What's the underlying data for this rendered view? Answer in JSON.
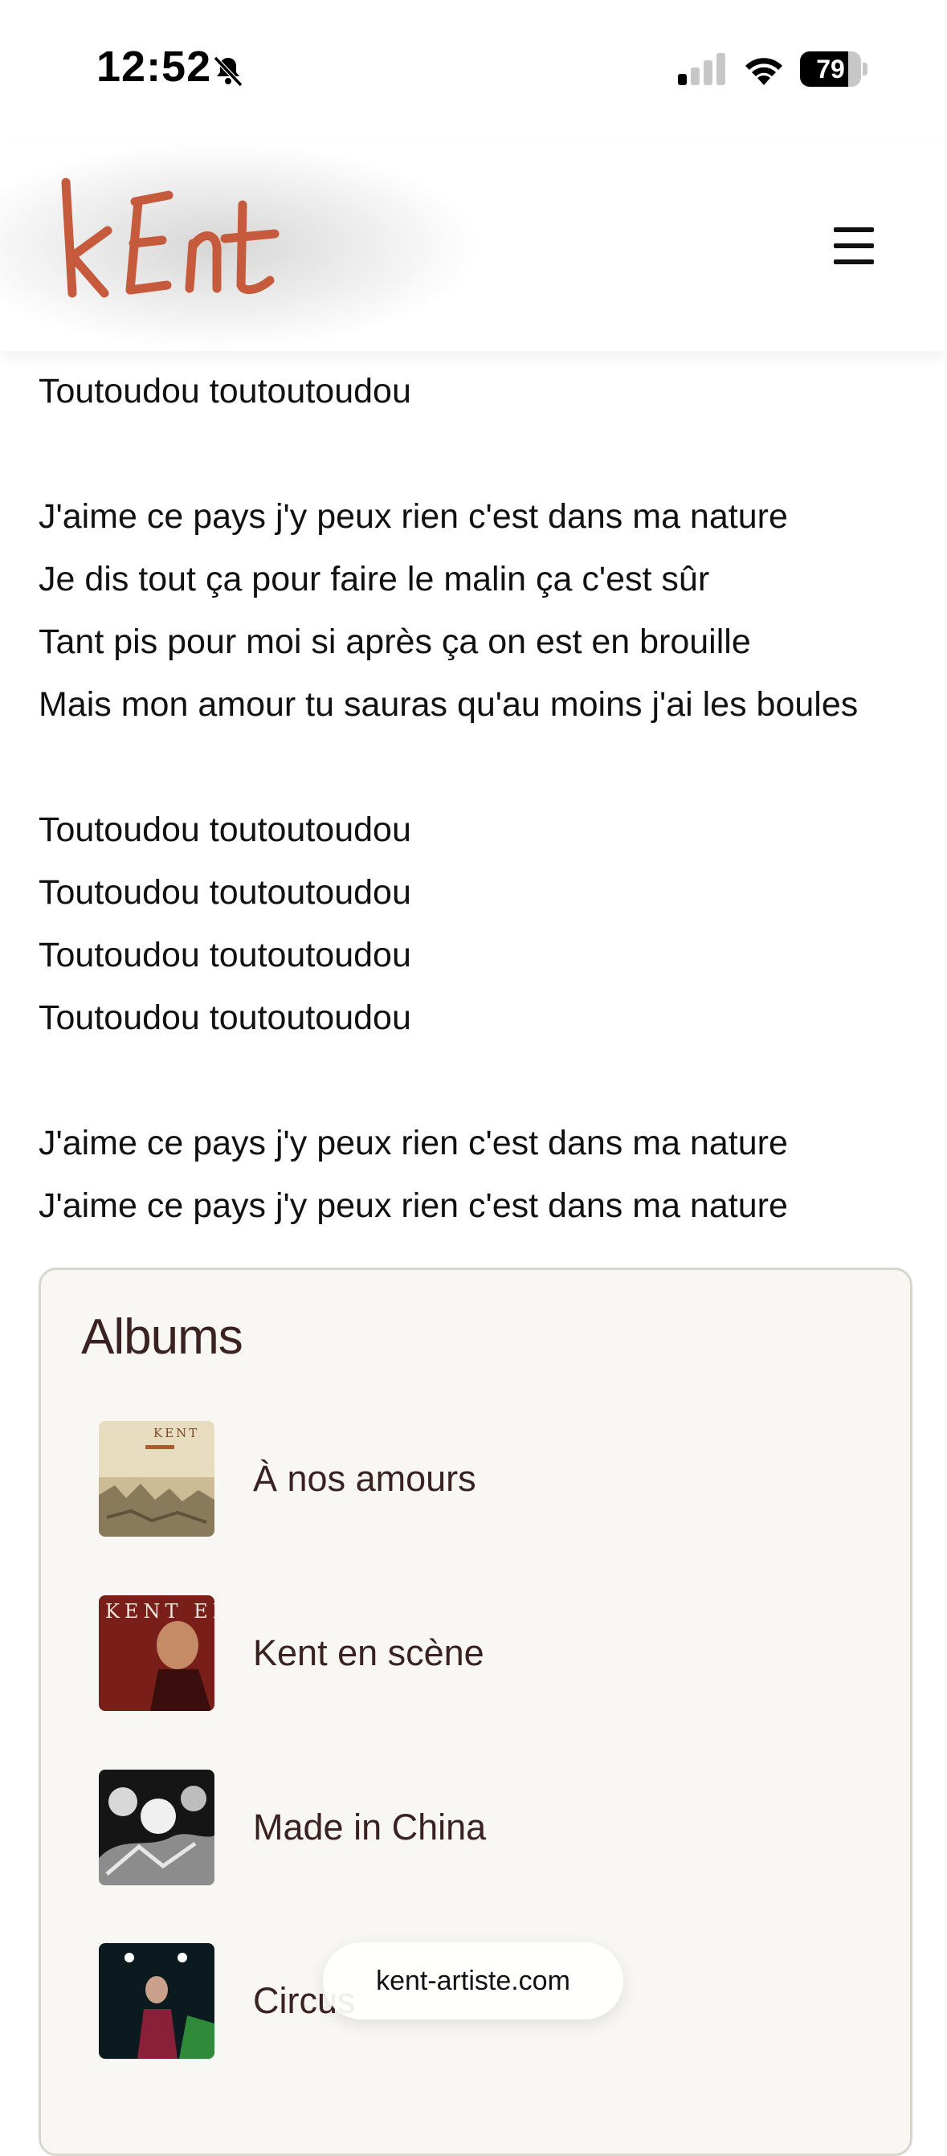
{
  "status_bar": {
    "time": "12:52",
    "battery_percent": "79",
    "battery_level": 0.79,
    "signal_bars_active": 1,
    "signal_bars_total": 4
  },
  "header": {
    "logo_text": "kEnt",
    "logo_color": "#c65a3c",
    "menu_icon": "hamburger-icon"
  },
  "lyrics": {
    "stanzas": [
      [
        "Toutoudou toutoutoudou"
      ],
      [
        "J'aime ce pays j'y peux rien c'est dans ma nature",
        "Je dis tout ça pour faire le malin ça c'est sûr",
        "Tant pis pour moi si après ça on est en brouille",
        "Mais mon amour tu sauras qu'au moins j'ai les boules"
      ],
      [
        "Toutoudou toutoutoudou",
        "Toutoudou toutoutoudou",
        "Toutoudou toutoutoudou",
        "Toutoudou toutoutoudou"
      ],
      [
        "J'aime ce pays j'y peux rien c'est dans ma nature",
        "J'aime ce pays j'y peux rien c'est dans ma nature"
      ]
    ]
  },
  "albums": {
    "title": "Albums",
    "items": [
      {
        "label": "À nos amours",
        "cover": "a-nos-amours-cover",
        "cover_text": "KENT"
      },
      {
        "label": "Kent en scène",
        "cover": "kent-en-scene-cover",
        "cover_text": "KENT EN SCENE"
      },
      {
        "label": "Made in China",
        "cover": "made-in-china-cover"
      },
      {
        "label": "Circus",
        "cover": "circus-cover"
      }
    ]
  },
  "browser": {
    "url": "kent-artiste.com"
  }
}
